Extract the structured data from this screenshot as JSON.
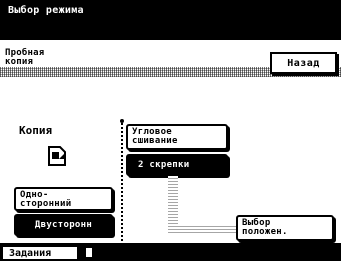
{
  "title": "Выбор режима",
  "header": {
    "label_line1": "Пробная",
    "label_line2": "копия",
    "back_label": "Назад"
  },
  "main": {
    "copy_label": "Копия",
    "one_sided_line1": "Одно-",
    "one_sided_line2": "сторонний",
    "two_sided": "Двусторонн",
    "corner_line1": "Угловое",
    "corner_line2": "сшивание",
    "two_staples": "2 скрепки",
    "position_line1": "Выбор",
    "position_line2": "положен."
  },
  "bottom": {
    "jobs_label": "Задания"
  },
  "colors": {
    "background": "#ffffff",
    "foreground": "#000000"
  }
}
